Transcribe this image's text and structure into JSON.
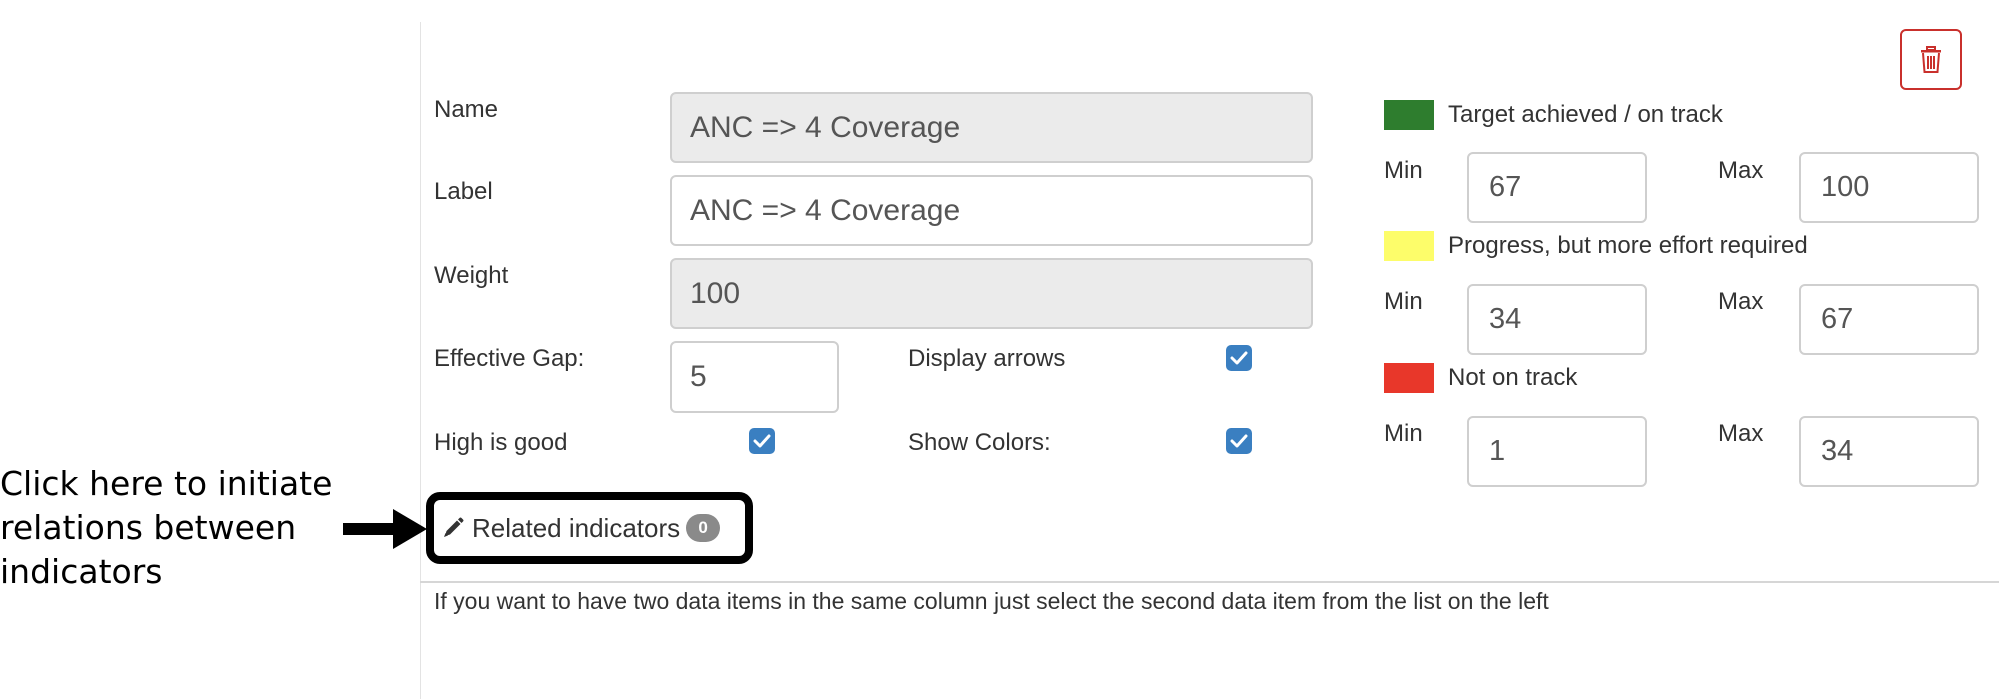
{
  "form": {
    "name_label": "Name",
    "name_value": "ANC => 4 Coverage",
    "label_label": "Label",
    "label_value": "ANC => 4 Coverage",
    "weight_label": "Weight",
    "weight_value": "100",
    "gap_label": "Effective Gap:",
    "gap_value": "5",
    "display_arrows_label": "Display arrows",
    "display_arrows_checked": true,
    "high_is_good_label": "High is good",
    "high_is_good_checked": true,
    "show_colors_label": "Show Colors:",
    "show_colors_checked": true
  },
  "legend": {
    "min_label": "Min",
    "max_label": "Max",
    "items": [
      {
        "label": "Target achieved / on track",
        "color": "#2e7d2e",
        "min": "67",
        "max": "100"
      },
      {
        "label": "Progress, but more effort required",
        "color": "#fdfd6a",
        "min": "34",
        "max": "67"
      },
      {
        "label": "Not on track",
        "color": "#e8372a",
        "min": "1",
        "max": "34"
      }
    ]
  },
  "related": {
    "label": "Related indicators",
    "count": "0",
    "icon": "pencil-icon"
  },
  "annotation": {
    "text": "Click here to initiate relations between indicators"
  },
  "delete_icon": "trash-icon",
  "note": "If you want to have two data items in the same column just select the second data item from the list on the left"
}
